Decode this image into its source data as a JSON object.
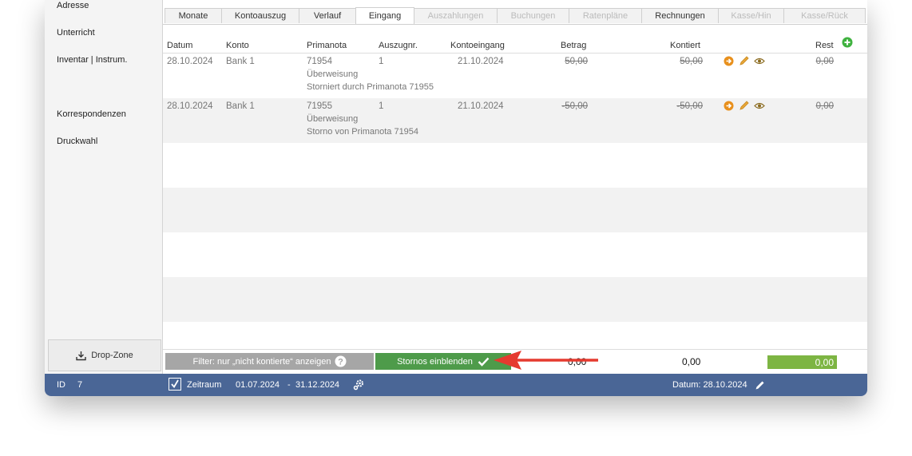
{
  "sidebar": {
    "items": [
      {
        "label": "Adresse"
      },
      {
        "label": "Unterricht"
      },
      {
        "label": "Inventar | Instrum."
      },
      {
        "label": "Korrespondenzen"
      },
      {
        "label": "Druckwahl"
      }
    ],
    "dropzone_label": "Drop-Zone"
  },
  "tabs": [
    {
      "label": "Monate"
    },
    {
      "label": "Kontoauszug"
    },
    {
      "label": "Verlauf"
    },
    {
      "label": "Eingang"
    },
    {
      "label": "Auszahlungen"
    },
    {
      "label": "Buchungen"
    },
    {
      "label": "Ratenpläne"
    },
    {
      "label": "Rechnungen"
    },
    {
      "label": "Kasse/Hin"
    },
    {
      "label": "Kasse/Rück"
    }
  ],
  "columns": {
    "datum": "Datum",
    "konto": "Konto",
    "primanota": "Primanota",
    "auszugnr": "Auszugnr.",
    "kontoeingang": "Kontoeingang",
    "betrag": "Betrag",
    "kontiert": "Kontiert",
    "rest": "Rest"
  },
  "rows": [
    {
      "datum": "28.10.2024",
      "konto": "Bank 1",
      "primanota": "71954",
      "typ": "Überweisung",
      "note": "Storniert durch Primanota 71955",
      "auszugnr": "1",
      "kontoeingang": "21.10.2024",
      "betrag": "50,00",
      "kontiert": "50,00",
      "rest": "0,00"
    },
    {
      "datum": "28.10.2024",
      "konto": "Bank 1",
      "primanota": "71955",
      "typ": "Überweisung",
      "note": "Storno von Primanota 71954",
      "auszugnr": "1",
      "kontoeingang": "21.10.2024",
      "betrag": "-50,00",
      "kontiert": "-50,00",
      "rest": "0,00"
    }
  ],
  "footer": {
    "filter_label": "Filter: nur „nicht kontierte“ anzeigen",
    "stornos_label": "Stornos einblenden",
    "sum_betrag": "0,00",
    "sum_kontiert": "0,00",
    "sum_rest": "0,00"
  },
  "status": {
    "id_label": "ID",
    "id_value": "7",
    "zeitraum_label": "Zeitraum",
    "zeitraum_from": "01.07.2024",
    "zeitraum_sep": "-",
    "zeitraum_to": "31.12.2024",
    "datum_label": "Datum: 28.10.2024"
  },
  "colors": {
    "statusbar": "#4a6696",
    "storno_button": "#4e9b4a",
    "filter_button": "#a6a6a6",
    "rest_box": "#7db543",
    "arrow": "#e53a2f",
    "icon_orange": "#e8901d",
    "add_icon": "#3fb23f"
  }
}
